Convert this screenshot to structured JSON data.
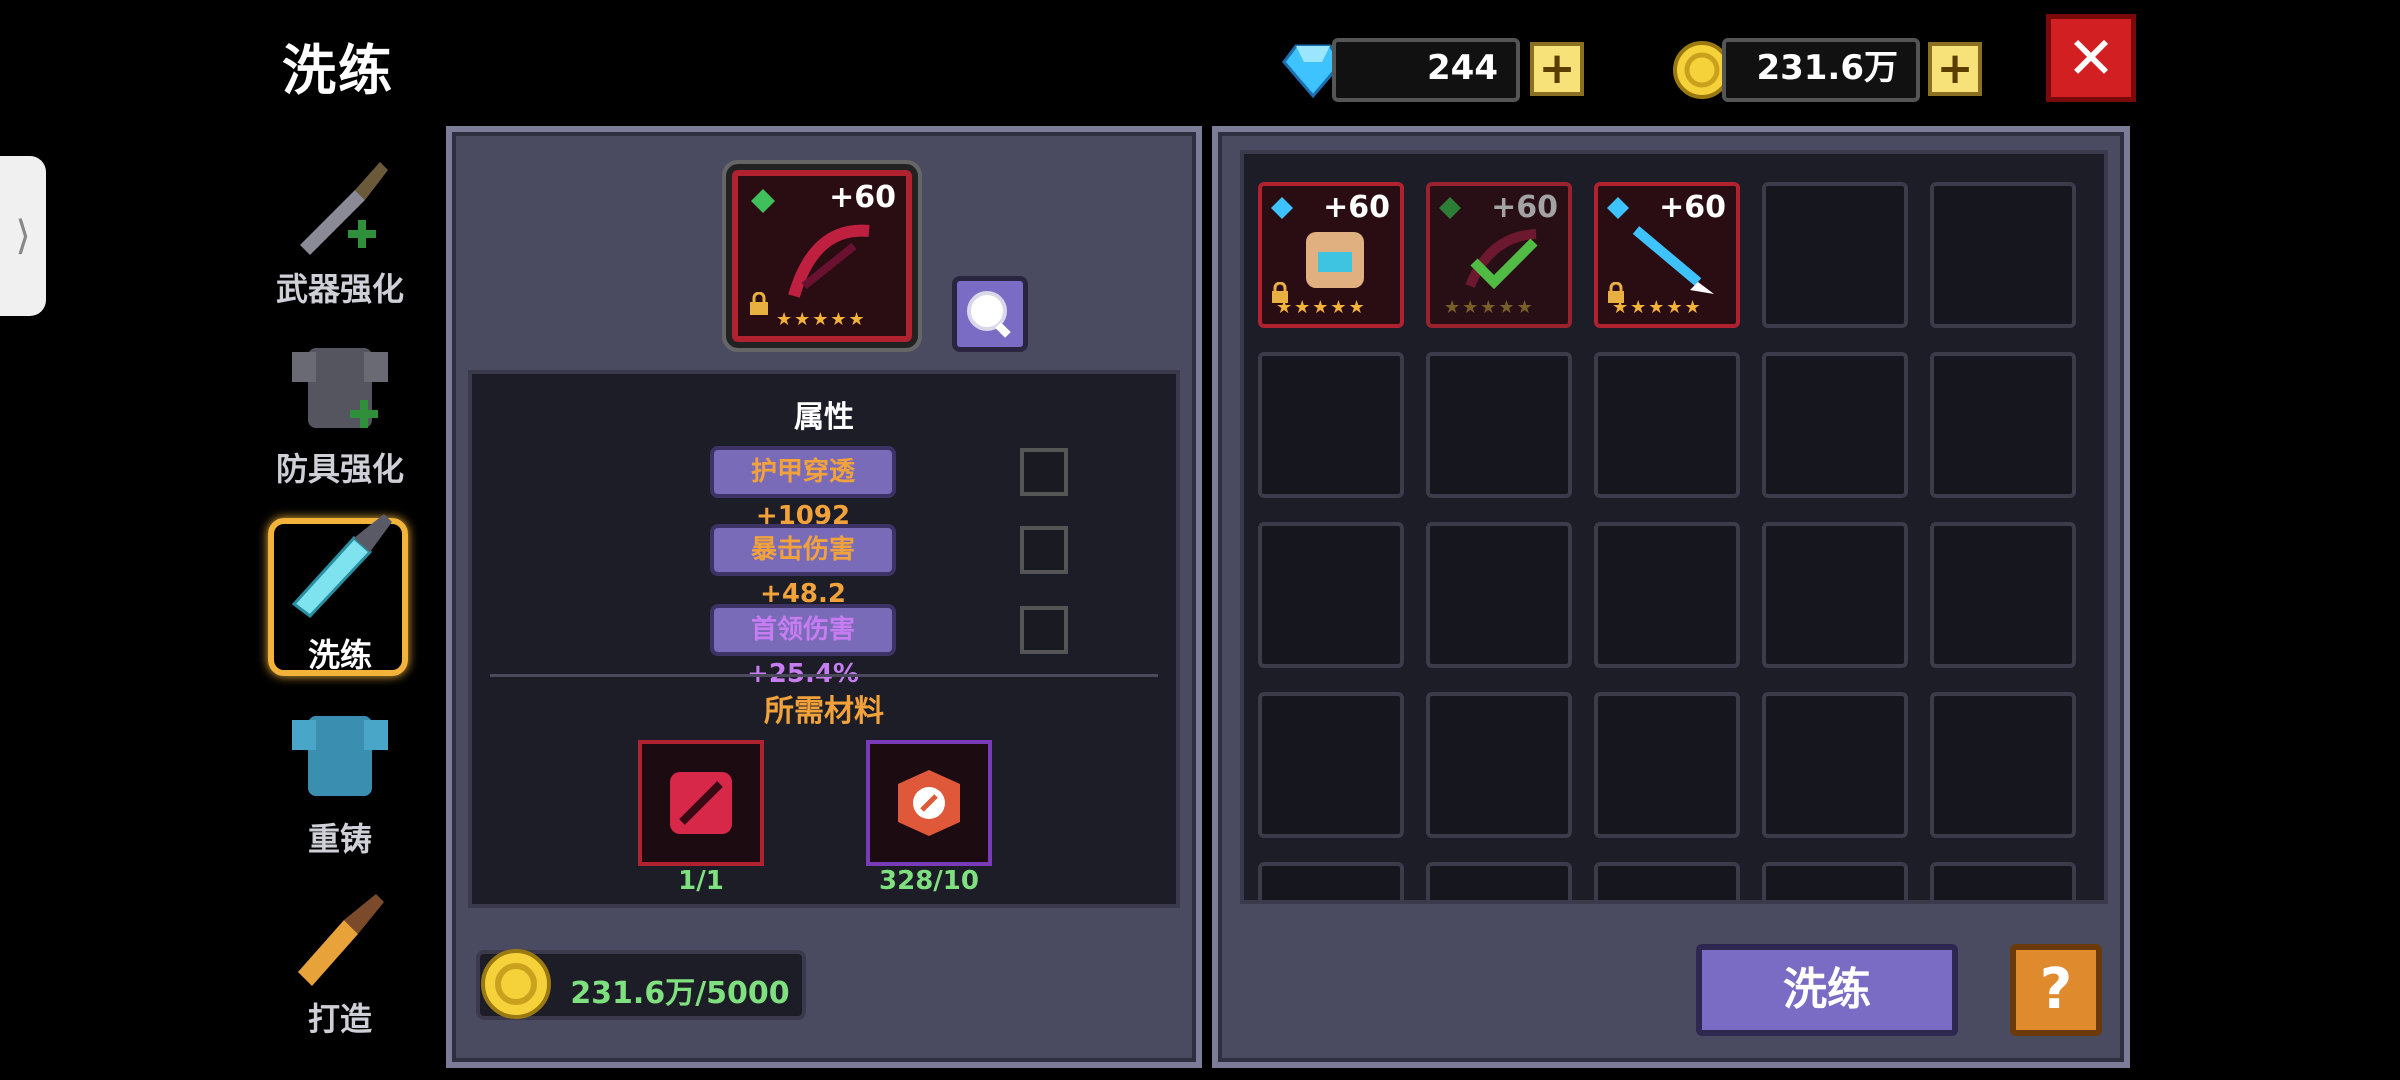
{
  "header": {
    "title": "洗练"
  },
  "resources": {
    "gems": "244",
    "gold": "231.6万"
  },
  "menu": [
    {
      "label": "武器强化"
    },
    {
      "label": "防具强化"
    },
    {
      "label": "洗练"
    },
    {
      "label": "重铸"
    },
    {
      "label": "打造"
    }
  ],
  "selected_item": {
    "level": "+60",
    "stars": "★★★★★"
  },
  "attributes": {
    "heading": "属性",
    "items": [
      {
        "text": "护甲穿透+1092",
        "color": "#f2a23a"
      },
      {
        "text": "暴击伤害+48.2",
        "color": "#f2a23a"
      },
      {
        "text": "首领伤害+25.4%",
        "color": "#c77cf2"
      }
    ]
  },
  "materials": {
    "heading": "所需材料",
    "items": [
      {
        "count": "1/1"
      },
      {
        "count": "328/10"
      }
    ]
  },
  "cost": {
    "text": "231.6万/5000"
  },
  "inventory": [
    {
      "level": "+60",
      "stars": "★★★★★"
    },
    {
      "level": "+60",
      "stars": "★★★★★"
    },
    {
      "level": "+60",
      "stars": "★★★★★"
    }
  ],
  "buttons": {
    "refine": "洗练",
    "help": "?",
    "close": "✕"
  },
  "colors": {
    "panel": "#4a4a60",
    "accent": "#7a6bc4",
    "gold": "#f3c53b",
    "close": "#d11f22"
  }
}
